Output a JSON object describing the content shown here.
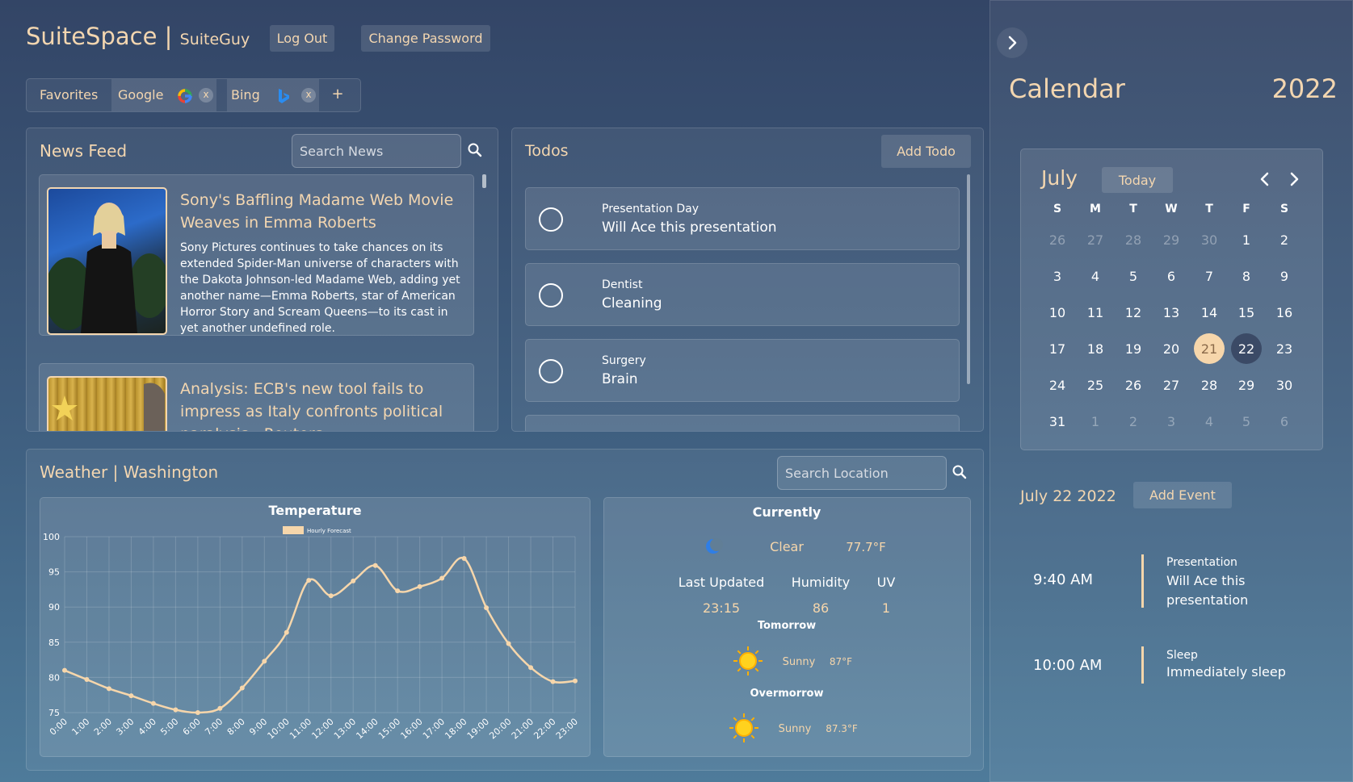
{
  "header": {
    "app_name": "SuiteSpace",
    "separator": "|",
    "username": "SuiteGuy",
    "logout_label": "Log Out",
    "change_password_label": "Change Password"
  },
  "favorites": {
    "label": "Favorites",
    "items": [
      {
        "label": "Google",
        "icon": "google-icon",
        "remove": "x"
      },
      {
        "label": "Bing",
        "icon": "bing-icon",
        "remove": "x"
      }
    ],
    "add": "+"
  },
  "news": {
    "title": "News Feed",
    "search_placeholder": "Search News",
    "articles": [
      {
        "title": "Sony's Baffling Madame Web Movie Weaves in Emma Roberts",
        "body": "Sony Pictures continues to take chances on its extended Spider-Man universe of characters with the Dakota Johnson-led Madame Web, adding yet another name—Emma Roberts, star of American Horror Story and Scream Queens—to its cast in yet another undefined role."
      },
      {
        "title": "Analysis: ECB's new tool fails to impress as Italy confronts political paralysis - Reuters",
        "body": ""
      }
    ]
  },
  "todos": {
    "title": "Todos",
    "add_label": "Add Todo",
    "items": [
      {
        "title": "Presentation Day",
        "desc": "Will Ace this presentation"
      },
      {
        "title": "Dentist",
        "desc": "Cleaning"
      },
      {
        "title": "Surgery",
        "desc": "Brain"
      }
    ]
  },
  "weather": {
    "title": "Weather | Washington",
    "search_placeholder": "Search Location",
    "currently": {
      "heading": "Currently",
      "icon": "moon-icon",
      "condition": "Clear",
      "temp": "77.7°F",
      "last_updated_label": "Last Updated",
      "last_updated": "23:15",
      "humidity_label": "Humidity",
      "humidity": "86",
      "uv_label": "UV",
      "uv": "1"
    },
    "tomorrow": {
      "heading": "Tomorrow",
      "icon": "sun-icon",
      "condition": "Sunny",
      "temp": "87°F"
    },
    "overmorrow": {
      "heading": "Overmorrow",
      "icon": "sun-icon",
      "condition": "Sunny",
      "temp": "87.3°F"
    }
  },
  "chart_data": {
    "type": "line",
    "title": "Temperature",
    "series": [
      {
        "name": "Hourly Forecast",
        "values": [
          81,
          79.7,
          78.4,
          77.4,
          76.3,
          75.4,
          75,
          75.6,
          78.5,
          82.3,
          86.4,
          93.8,
          91.6,
          93.7,
          95.9,
          92.3,
          92.9,
          94.1,
          96.9,
          89.9,
          84.8,
          81.4,
          79.4,
          79.5
        ],
        "color": "#f6d6ab"
      }
    ],
    "x": [
      "0:00",
      "1:00",
      "2:00",
      "3:00",
      "4:00",
      "5:00",
      "6:00",
      "7:00",
      "8:00",
      "9:00",
      "10:00",
      "11:00",
      "12:00",
      "13:00",
      "14:00",
      "15:00",
      "16:00",
      "17:00",
      "18:00",
      "19:00",
      "20:00",
      "21:00",
      "22:00",
      "23:00"
    ],
    "yticks": [
      75,
      80,
      85,
      90,
      95,
      100
    ],
    "ylim": [
      75,
      100
    ],
    "grid": true,
    "legend": "top"
  },
  "calendar": {
    "title": "Calendar",
    "year": "2022",
    "month": "July",
    "today_label": "Today",
    "weekdays": [
      "S",
      "M",
      "T",
      "W",
      "T",
      "F",
      "S"
    ],
    "weeks": [
      [
        "26",
        "27",
        "28",
        "29",
        "30",
        "1",
        "2"
      ],
      [
        "3",
        "4",
        "5",
        "6",
        "7",
        "8",
        "9"
      ],
      [
        "10",
        "11",
        "12",
        "13",
        "14",
        "15",
        "16"
      ],
      [
        "17",
        "18",
        "19",
        "20",
        "21",
        "22",
        "23"
      ],
      [
        "24",
        "25",
        "26",
        "27",
        "28",
        "29",
        "30"
      ],
      [
        "31",
        "1",
        "2",
        "3",
        "4",
        "5",
        "6"
      ]
    ],
    "today": "21",
    "selected": "22",
    "selected_date_label": "July 22 2022",
    "add_event_label": "Add Event",
    "events": [
      {
        "time": "9:40 AM",
        "title": "Presentation",
        "desc": "Will Ace this presentation"
      },
      {
        "time": "10:00 AM",
        "title": "Sleep",
        "desc": "Immediately sleep"
      }
    ]
  },
  "colors": {
    "accent": "#f6d6ab",
    "today_fill": "#f6d6ab",
    "selected_fill": "#3b4a66"
  }
}
